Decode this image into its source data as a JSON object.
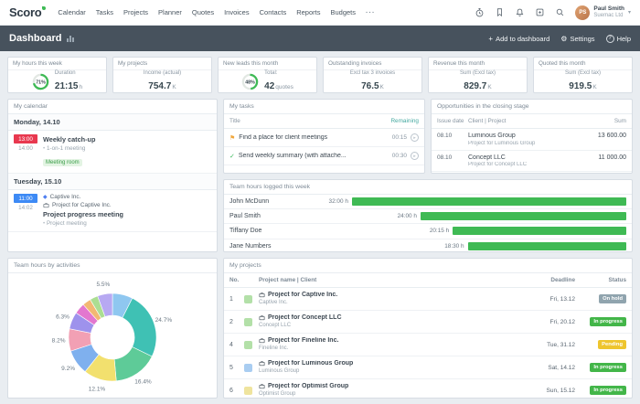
{
  "nav": {
    "logo": "Scoro",
    "items": [
      "Calendar",
      "Tasks",
      "Projects",
      "Planner",
      "Quotes",
      "Invoices",
      "Contacts",
      "Reports",
      "Budgets"
    ],
    "user": {
      "name": "Paul Smith",
      "company": "Suemac Ltd",
      "initials": "PS"
    }
  },
  "header": {
    "title": "Dashboard",
    "add": "Add to dashboard",
    "settings": "Settings",
    "help": "Help"
  },
  "icons": {
    "plus": "+",
    "gear": "⚙",
    "help": "?",
    "chevron_down": "▾",
    "more": "···",
    "flag": "⚑",
    "check": "✓",
    "play": "▸",
    "bullet": "•",
    "diamond": "◆"
  },
  "kpis": {
    "hours": {
      "title": "My hours this week",
      "percent": "71%",
      "label": "Duration",
      "value": "21:15",
      "unit": "h"
    },
    "projects": {
      "title": "My projects",
      "label": "Income (actual)",
      "value": "754.7",
      "unit": "K"
    },
    "leads": {
      "title": "New leads this month",
      "percent": "48%",
      "label": "Total:",
      "value": "42",
      "unit": "quotes"
    },
    "outstanding": {
      "title": "Outstanding invoices",
      "label": "Excl tax 3 invoices",
      "value": "76.5",
      "unit": "K"
    },
    "revenue": {
      "title": "Revenue this month",
      "label": "Sum (Excl tax)",
      "value": "829.7",
      "unit": "K"
    },
    "quoted": {
      "title": "Quoted this month",
      "label": "Sum (Excl tax)",
      "value": "919.5",
      "unit": "K"
    }
  },
  "calendar": {
    "title": "My calendar",
    "monday": {
      "date": "Monday, 14.10",
      "event": {
        "start": "13:00",
        "end": "14:00",
        "title": "Weekly catch-up",
        "subtitle": "1-on-1 meeting",
        "tag": "Meeting room"
      }
    },
    "tuesday": {
      "date": "Tuesday, 15.10",
      "event": {
        "start": "11:00",
        "end": "14:02",
        "company": "Captive Inc.",
        "project": "Project for Captive Inc.",
        "title": "Project progress meeting",
        "subtitle": "Project meeting"
      }
    }
  },
  "tasks": {
    "title": "My tasks",
    "col_title": "Title",
    "col_remaining": "Remaining",
    "rows": [
      {
        "title": "Find a place for client meetings",
        "remaining": "00:15"
      },
      {
        "title": "Send weekly summary (with attache...",
        "remaining": "00:30"
      }
    ]
  },
  "opportunities": {
    "title": "Opportunities in the closing stage",
    "col_date": "Issue date",
    "col_client": "Client | Project",
    "col_sum": "Sum",
    "rows": [
      {
        "date": "08.10",
        "client": "Luminous Group",
        "project": "Project for Luminous Group",
        "sum": "13 600.00"
      },
      {
        "date": "08.10",
        "client": "Concept LLC",
        "project": "Project for Concept LLC",
        "sum": "11 000.00"
      }
    ]
  },
  "team_hours": {
    "title": "Team hours logged this week"
  },
  "activities": {
    "title": "Team hours by activities"
  },
  "projects_table": {
    "title": "My projects",
    "col_no": "No.",
    "col_name": "Project name | Client",
    "col_deadline": "Deadline",
    "col_status": "Status",
    "rows": [
      {
        "no": "1",
        "name": "Project for Captive Inc.",
        "client": "Captive Inc.",
        "deadline": "Fri, 13.12",
        "status": "On hold",
        "status_color": "#90a4ae",
        "swatch": "#b3e0a8"
      },
      {
        "no": "2",
        "name": "Project for Concept LLC",
        "client": "Concept LLC",
        "deadline": "Fri, 20.12",
        "status": "In progress",
        "status_color": "#43b649",
        "swatch": "#b3e0a8"
      },
      {
        "no": "4",
        "name": "Project for Fineline Inc.",
        "client": "Fineline Inc.",
        "deadline": "Tue, 31.12",
        "status": "Pending",
        "status_color": "#eec52e",
        "swatch": "#b3e0a8"
      },
      {
        "no": "5",
        "name": "Project for Luminous Group",
        "client": "Luminous Group",
        "deadline": "Sat, 14.12",
        "status": "In progress",
        "status_color": "#43b649",
        "swatch": "#a9cdf1"
      },
      {
        "no": "6",
        "name": "Project for Optimist Group",
        "client": "Optimist Group",
        "deadline": "Sun, 15.12",
        "status": "In progress",
        "status_color": "#43b649",
        "swatch": "#efe49e"
      }
    ]
  },
  "chart_data": [
    {
      "type": "bar",
      "title": "Team hours logged this week",
      "orientation": "horizontal",
      "categories": [
        "John McDunn",
        "Paul Smith",
        "Tiffany Doe",
        "Jane Numbers"
      ],
      "values": [
        32.0,
        24.0,
        20.25,
        18.5
      ],
      "value_labels": [
        "32:00 h",
        "24:00 h",
        "20:15 h",
        "18:30 h"
      ],
      "bar_color": "#3fba54",
      "xlim": [
        0,
        32
      ],
      "grid": false,
      "legend": false
    },
    {
      "type": "pie",
      "title": "Team hours by activities",
      "donut": true,
      "slices": [
        {
          "value": 7.5,
          "color": "#8fc7f0",
          "label": ""
        },
        {
          "value": 24.7,
          "color": "#3fc1b4",
          "label": "24.7%"
        },
        {
          "value": 16.4,
          "color": "#5ecb98",
          "label": "16.4%"
        },
        {
          "value": 12.1,
          "color": "#f2e06e",
          "label": "12.1%"
        },
        {
          "value": 9.2,
          "color": "#7fb0ee",
          "label": "9.2%"
        },
        {
          "value": 8.2,
          "color": "#f2a0b4",
          "label": "8.2%"
        },
        {
          "value": 6.3,
          "color": "#9e92ec",
          "label": "6.3%"
        },
        {
          "value": 4.0,
          "color": "#e377cf",
          "label": ""
        },
        {
          "value": 3.1,
          "color": "#f2b873",
          "label": ""
        },
        {
          "value": 3.0,
          "color": "#abde92",
          "label": ""
        },
        {
          "value": 5.5,
          "color": "#b7a9f2",
          "label": "5.5%"
        }
      ]
    }
  ]
}
